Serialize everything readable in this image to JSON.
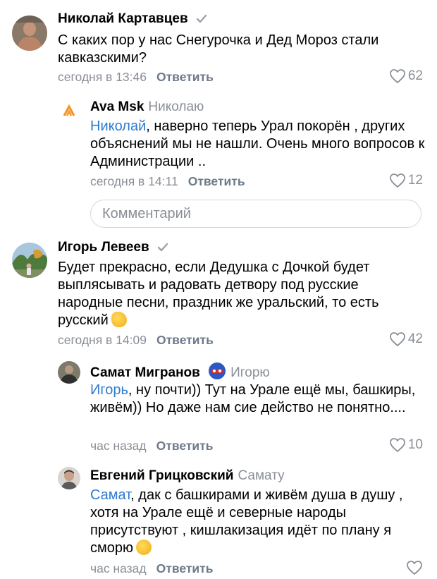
{
  "comments": [
    {
      "author": "Николай Картавцев",
      "text": "С каких пор у нас Снегурочка и Дед Мороз стали кавказскими?",
      "time": "сегодня в 13:46",
      "reply_label": "Ответить",
      "likes": "62"
    },
    {
      "author": "Ava Msk",
      "reply_to": "Николаю",
      "mention": "Николай",
      "text": ", наверно теперь Урал покорён , других объяснений мы не нашли. Очень много вопросов к Администрации ..",
      "time": "сегодня в 14:11",
      "reply_label": "Ответить",
      "likes": "12"
    },
    {
      "author": "Игорь Левеев",
      "text": "Будет прекрасно, если Дедушка с Дочкой будет выплясывать и радовать детвору под русские народные песни, праздник же уральский, то есть русский",
      "time": "сегодня в 14:09",
      "reply_label": "Ответить",
      "likes": "42"
    },
    {
      "author": "Самат Мигранов",
      "reply_to": "Игорю",
      "mention": "Игорь",
      "text": ", ну почти)) Тут на Урале ещё мы, башкиры, живём)) Но даже нам сие действо не понятно....",
      "time": "час назад",
      "reply_label": "Ответить",
      "likes": "10"
    },
    {
      "author": "Евгений Грицковский",
      "reply_to": "Самату",
      "mention": "Самат",
      "text": ", дак с башкирами и живём душа в душу , хотя на Урале ещё и северные народы присутствуют , кишлакизация идёт по плану я сморю",
      "time": "час назад",
      "reply_label": "Ответить",
      "likes": ""
    }
  ],
  "comment_input": {
    "placeholder": "Комментарий"
  },
  "colors": {
    "mention": "#2d7bd1",
    "muted": "#8a8f96",
    "reply": "#6c7a89"
  },
  "icons": [
    "verified-check-icon",
    "heart-icon",
    "ok-hand-emoji-icon",
    "smirk-emoji-icon",
    "ava-logo-icon"
  ]
}
